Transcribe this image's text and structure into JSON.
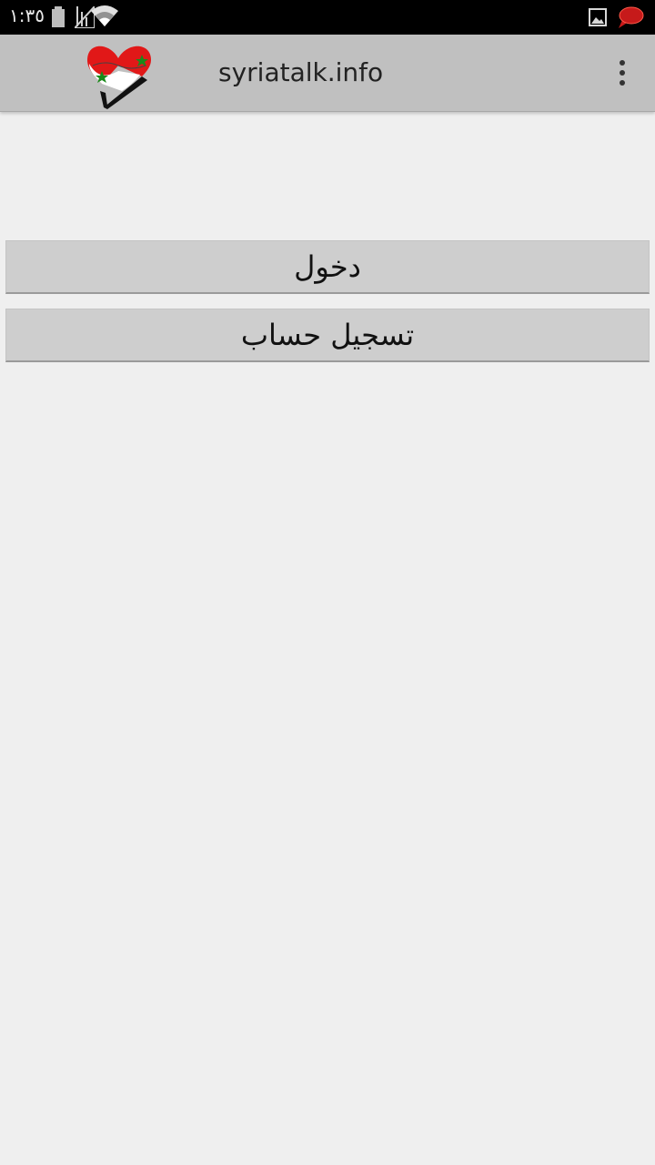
{
  "status_bar": {
    "time": "١:٣٥",
    "icons": [
      "battery-icon",
      "signal-icon",
      "wifi-icon",
      "gallery-notification-icon",
      "chat-notification-icon"
    ]
  },
  "action_bar": {
    "title": "syriatalk.info",
    "logo": "syria-heart-logo",
    "menu_icon": "overflow-menu-icon"
  },
  "buttons": {
    "login_label": "دخول",
    "register_label": "تسجيل حساب"
  },
  "colors": {
    "status_bar_bg": "#000000",
    "action_bar_bg": "#c0c0c0",
    "page_bg": "#efefef",
    "button_bg": "#cecece"
  }
}
